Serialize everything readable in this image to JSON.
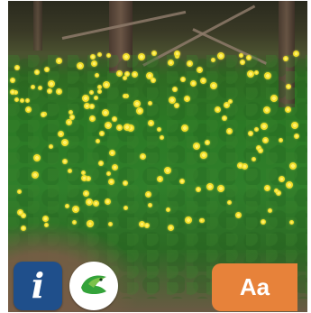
{
  "photo": {
    "subject": "yellow-flowers-on-green-clover-field"
  },
  "badges": {
    "info": {
      "glyph": "i",
      "icon": "info-icon"
    },
    "bird": {
      "icon": "bird-logo-icon"
    },
    "text_size": {
      "label": "Aa"
    }
  },
  "colors": {
    "info_bg": "#1f4f8b",
    "aa_bg": "#e7823a",
    "bird_green": "#34a33a",
    "flower_yellow": "#f2de2a"
  }
}
